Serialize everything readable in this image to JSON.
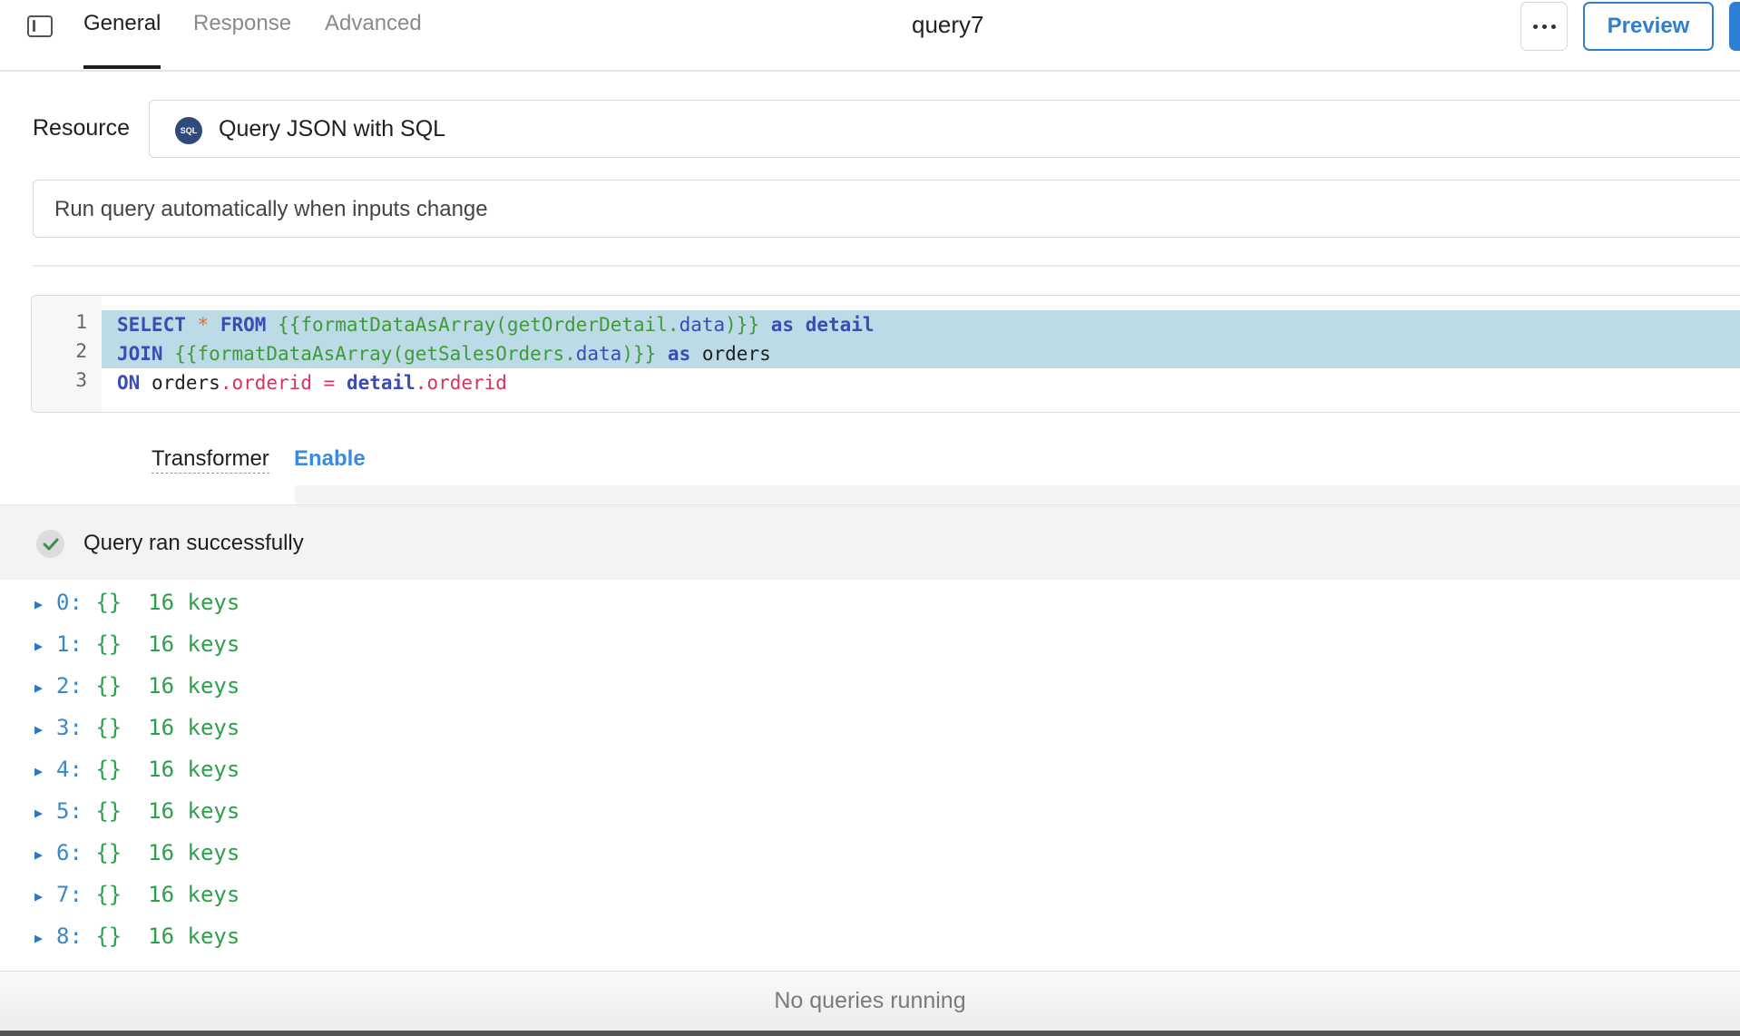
{
  "header": {
    "tabs": [
      {
        "label": "General",
        "active": true
      },
      {
        "label": "Response",
        "active": false
      },
      {
        "label": "Advanced",
        "active": false
      }
    ],
    "title": "query7",
    "preview_label": "Preview",
    "more_icon": "ellipsis-icon",
    "sidebar_icon": "sidebar-toggle-icon"
  },
  "resource": {
    "label": "Resource",
    "badge": "SQL",
    "value": "Query JSON with SQL"
  },
  "run_mode": {
    "value": "Run query automatically when inputs change"
  },
  "editor": {
    "line_numbers": [
      "1",
      "2",
      "3"
    ],
    "lines": [
      "SELECT * FROM {{formatDataAsArray(getOrderDetail.data)}} as detail",
      "JOIN {{formatDataAsArray(getSalesOrders.data)}} as orders",
      "ON orders.orderid = detail.orderid"
    ],
    "selection_color": "#bcdbe6"
  },
  "transformer": {
    "label": "Transformer",
    "action": "Enable"
  },
  "status": {
    "icon": "check-circle-icon",
    "text": "Query ran successfully"
  },
  "results": [
    {
      "index": "0:",
      "type": "{}",
      "count": "16 keys"
    },
    {
      "index": "1:",
      "type": "{}",
      "count": "16 keys"
    },
    {
      "index": "2:",
      "type": "{}",
      "count": "16 keys"
    },
    {
      "index": "3:",
      "type": "{}",
      "count": "16 keys"
    },
    {
      "index": "4:",
      "type": "{}",
      "count": "16 keys"
    },
    {
      "index": "5:",
      "type": "{}",
      "count": "16 keys"
    },
    {
      "index": "6:",
      "type": "{}",
      "count": "16 keys"
    },
    {
      "index": "7:",
      "type": "{}",
      "count": "16 keys"
    },
    {
      "index": "8:",
      "type": "{}",
      "count": "16 keys"
    }
  ],
  "footer": {
    "text": "No queries running"
  },
  "colors": {
    "accent": "#2d7fd3",
    "success": "#3a8f4a",
    "result_green": "#2aa14a"
  }
}
